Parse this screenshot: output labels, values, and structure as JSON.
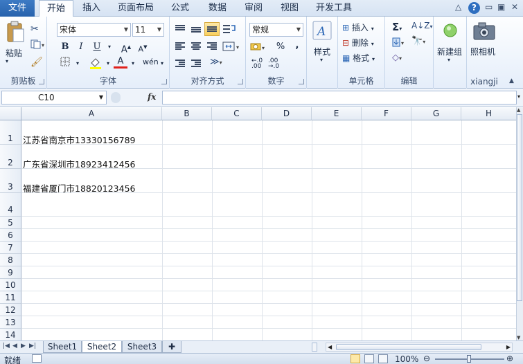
{
  "tabs": [
    "文件",
    "开始",
    "插入",
    "页面布局",
    "公式",
    "数据",
    "审阅",
    "视图",
    "开发工具"
  ],
  "groups": {
    "clipboard": {
      "label": "剪贴板",
      "paste": "粘贴"
    },
    "font": {
      "label": "字体",
      "name": "宋体",
      "size": "11"
    },
    "alignment": {
      "label": "对齐方式"
    },
    "number": {
      "label": "数字",
      "format": "常规",
      "percent": "%",
      "comma": ","
    },
    "styles": {
      "label": "样式"
    },
    "cells": {
      "label": "单元格",
      "insert": "插入",
      "delete": "删除",
      "format": "格式"
    },
    "editing": {
      "label": "编辑"
    },
    "newgroup": {
      "label": "新建组"
    },
    "xiangji": {
      "label": "xiangji",
      "camera": "照相机"
    }
  },
  "formula_bar": {
    "name_box": "C10",
    "fx": "fx",
    "value": ""
  },
  "columns": [
    "A",
    "B",
    "C",
    "D",
    "E",
    "F",
    "G",
    "H"
  ],
  "rows": [
    "1",
    "2",
    "3",
    "4",
    "5",
    "6",
    "7",
    "8",
    "9",
    "10",
    "11",
    "12",
    "13",
    "14"
  ],
  "cells": {
    "A1": "江苏省南京市13330156789",
    "A2": "广东省深圳市18923412456",
    "A3": "福建省厦门市18820123456"
  },
  "sheets": [
    "Sheet1",
    "Sheet2",
    "Sheet3"
  ],
  "active_sheet": "Sheet2",
  "status": {
    "ready": "就绪",
    "zoom": "100%"
  }
}
